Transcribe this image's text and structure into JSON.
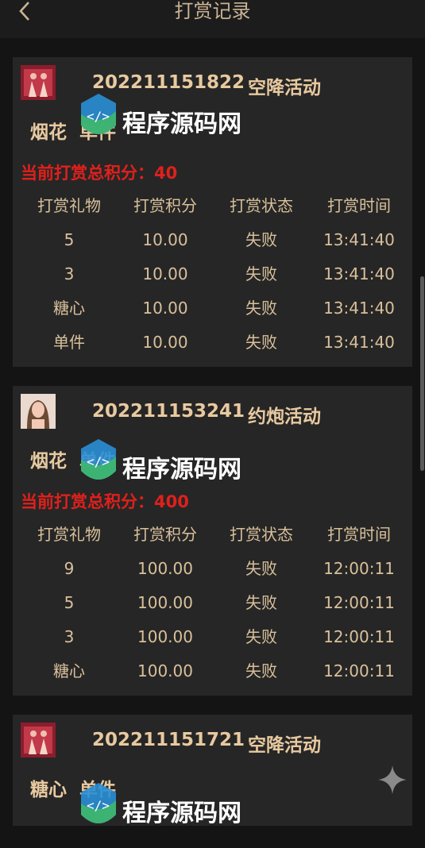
{
  "header": {
    "title": "打赏记录"
  },
  "table_headers": [
    "打赏礼物",
    "打赏积分",
    "打赏状态",
    "打赏时间"
  ],
  "watermark_text": "程序源码网",
  "cards": [
    {
      "order_no": "202211151822",
      "event": "空降活动",
      "gifts": [
        "烟花",
        "单件"
      ],
      "total": "当前打赏总积分：40",
      "rows": [
        [
          "5",
          "10.00",
          "失败",
          "13:41:40"
        ],
        [
          "3",
          "10.00",
          "失败",
          "13:41:40"
        ],
        [
          "糖心",
          "10.00",
          "失败",
          "13:41:40"
        ],
        [
          "单件",
          "10.00",
          "失败",
          "13:41:40"
        ]
      ]
    },
    {
      "order_no": "202211153241",
      "event": "约炮活动",
      "gifts": [
        "烟花",
        "单件"
      ],
      "total": "当前打赏总积分：400",
      "rows": [
        [
          "9",
          "100.00",
          "失败",
          "12:00:11"
        ],
        [
          "5",
          "100.00",
          "失败",
          "12:00:11"
        ],
        [
          "3",
          "100.00",
          "失败",
          "12:00:11"
        ],
        [
          "糖心",
          "100.00",
          "失败",
          "12:00:11"
        ]
      ]
    },
    {
      "order_no": "202211151721",
      "event": "空降活动",
      "gifts": [
        "糖心",
        "单件"
      ]
    }
  ],
  "colors": {
    "accent": "#e8c9a0",
    "total": "#e0201c",
    "card": "#262626",
    "background": "#141414"
  }
}
